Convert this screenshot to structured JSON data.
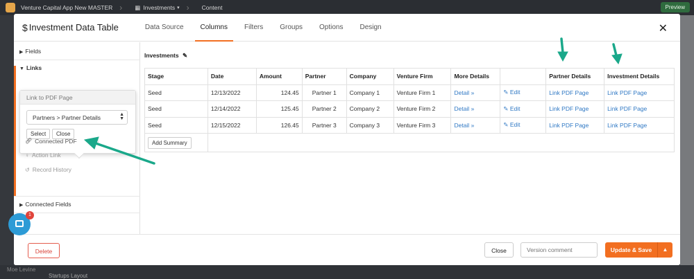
{
  "topbar": {
    "app_name": "Venture Capital App New MASTER",
    "section": "Investments",
    "page": "Content",
    "preview_label": "Preview"
  },
  "background": {
    "user_name": "Moe Levine",
    "layout_name": "Startups Layout"
  },
  "modal": {
    "title": "Investment Data Table",
    "tabs": [
      {
        "label": "Data Source"
      },
      {
        "label": "Columns"
      },
      {
        "label": "Filters"
      },
      {
        "label": "Groups"
      },
      {
        "label": "Options"
      },
      {
        "label": "Design"
      }
    ],
    "active_tab": "Columns"
  },
  "left_panel": {
    "fields_label": "Fields",
    "links_label": "Links",
    "popup": {
      "header": "Link to PDF Page",
      "selected_option": "Partners > Partner Details",
      "select_button": "Select",
      "close_button": "Close"
    },
    "items": [
      {
        "label": "Connected PDF"
      },
      {
        "label": "Action Link"
      },
      {
        "label": "Record History"
      }
    ],
    "connected_fields_label": "Connected Fields"
  },
  "table": {
    "title": "Investments",
    "headers": [
      "Stage",
      "Date",
      "Amount",
      "Partner",
      "Company",
      "Venture Firm",
      "More Details",
      "",
      "Partner Details",
      "Investment Details"
    ],
    "rows": [
      {
        "stage": "Seed",
        "date": "12/13/2022",
        "amount": "124.45",
        "partner": "Partner 1",
        "company": "Company 1",
        "firm": "Venture Firm 1",
        "details": "Detail",
        "edit": "Edit",
        "partner_link": "Link PDF Page",
        "invest_link": "Link PDF Page"
      },
      {
        "stage": "Seed",
        "date": "12/14/2022",
        "amount": "125.45",
        "partner": "Partner 2",
        "company": "Company 2",
        "firm": "Venture Firm 2",
        "details": "Detail",
        "edit": "Edit",
        "partner_link": "Link PDF Page",
        "invest_link": "Link PDF Page"
      },
      {
        "stage": "Seed",
        "date": "12/15/2022",
        "amount": "126.45",
        "partner": "Partner 3",
        "company": "Company 3",
        "firm": "Venture Firm 3",
        "details": "Detail",
        "edit": "Edit",
        "partner_link": "Link PDF Page",
        "invest_link": "Link PDF Page"
      }
    ],
    "add_summary_label": "Add Summary"
  },
  "footer": {
    "delete_label": "Delete",
    "close_label": "Close",
    "version_placeholder": "Version comment",
    "update_label": "Update & Save"
  },
  "chat": {
    "badge_count": "1"
  },
  "colors": {
    "accent": "#f26f21",
    "link": "#2f78c4",
    "arrow": "#1aa88a"
  }
}
